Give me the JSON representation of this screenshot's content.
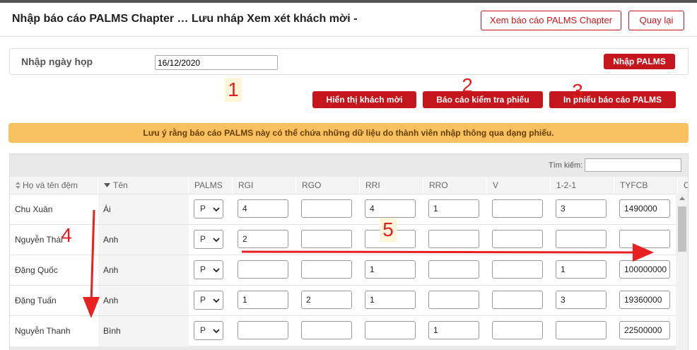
{
  "header": {
    "title": "Nhập báo cáo PALMS Chapter … Lưu nháp   Xem xét khách mời -",
    "view_report_btn": "Xem báo cáo PALMS Chapter",
    "back_btn": "Quay lại"
  },
  "meeting": {
    "label": "Nhập ngày họp",
    "date_value": "16/12/2020",
    "enter_palms_btn": "Nhập PALMS"
  },
  "actions": {
    "show_guests": "Hiển thị khách mời",
    "check_slips": "Báo cáo kiểm tra phiếu",
    "print_slips": "In phiếu báo cáo PALMS"
  },
  "notice": "Lưu ý rằng báo cáo PALMS này có thể chứa những dữ liệu do thành viên nhập thông qua dạng phiếu.",
  "table": {
    "search_label": "Tìm kiếm:",
    "search_value": "",
    "headers": [
      "Họ và tên đệm",
      "Tên",
      "PALMS",
      "RGI",
      "RGO",
      "RRI",
      "RRO",
      "V",
      "1-2-1",
      "TYFCB",
      "C"
    ],
    "rows": [
      {
        "hoten": "Chu Xuân",
        "ten": "Ái",
        "palms": "P",
        "vals": [
          "4",
          "",
          "4",
          "1",
          "",
          "3",
          "1490000"
        ]
      },
      {
        "hoten": "Nguyễn Thái",
        "ten": "Anh",
        "palms": "P",
        "vals": [
          "2",
          "",
          "",
          "",
          "",
          "",
          ""
        ]
      },
      {
        "hoten": "Đặng Quốc",
        "ten": "Anh",
        "palms": "P",
        "vals": [
          "",
          "",
          "1",
          "",
          "",
          "1",
          "100000000"
        ]
      },
      {
        "hoten": "Đặng Tuấn",
        "ten": "Anh",
        "palms": "P",
        "vals": [
          "1",
          "2",
          "1",
          "",
          "",
          "3",
          "19360000"
        ]
      },
      {
        "hoten": "Nguyễn Thanh",
        "ten": "Bình",
        "palms": "P",
        "vals": [
          "",
          "",
          "",
          "1",
          "",
          "",
          "22500000"
        ]
      }
    ]
  },
  "annotations": [
    "1",
    "2",
    "3",
    "4",
    "5"
  ],
  "colors": {
    "accent": "#c4161c",
    "notice_bg": "#f6c15e",
    "annotation": "#e02020"
  }
}
